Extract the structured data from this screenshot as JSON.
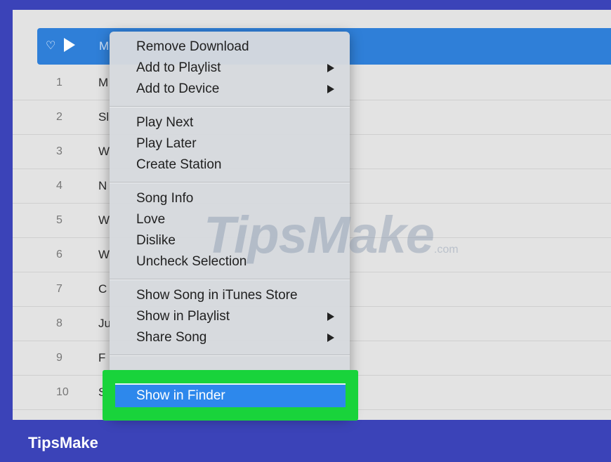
{
  "songs": [
    {
      "title": "M"
    },
    {
      "num": "1",
      "title": "M"
    },
    {
      "num": "2",
      "title": "Sl"
    },
    {
      "num": "3",
      "title": "W"
    },
    {
      "num": "4",
      "title": "N"
    },
    {
      "num": "5",
      "title": "W"
    },
    {
      "num": "6",
      "title": "W"
    },
    {
      "num": "7",
      "title": "C"
    },
    {
      "num": "8",
      "title": "Ju"
    },
    {
      "num": "9",
      "title": "F"
    },
    {
      "num": "10",
      "title": "S"
    }
  ],
  "menu": {
    "remove_download": "Remove Download",
    "add_to_playlist": "Add to Playlist",
    "add_to_device": "Add to Device",
    "play_next": "Play Next",
    "play_later": "Play Later",
    "create_station": "Create Station",
    "song_info": "Song Info",
    "love": "Love",
    "dislike": "Dislike",
    "uncheck_selection": "Uncheck Selection",
    "show_in_store": "Show Song in iTunes Store",
    "show_in_playlist": "Show in Playlist",
    "share_song": "Share Song",
    "show_in_finder": "Show in Finder"
  },
  "watermark": {
    "main": "TipsMake",
    "suffix": ".com"
  },
  "brand": "TipsMake",
  "icons": {
    "heart": "heart-icon",
    "play": "play-icon",
    "submenu": "submenu-arrow-icon"
  },
  "colors": {
    "selection": "#2f7fd8",
    "highlight": "#19d33b",
    "background": "#3b43b8"
  }
}
